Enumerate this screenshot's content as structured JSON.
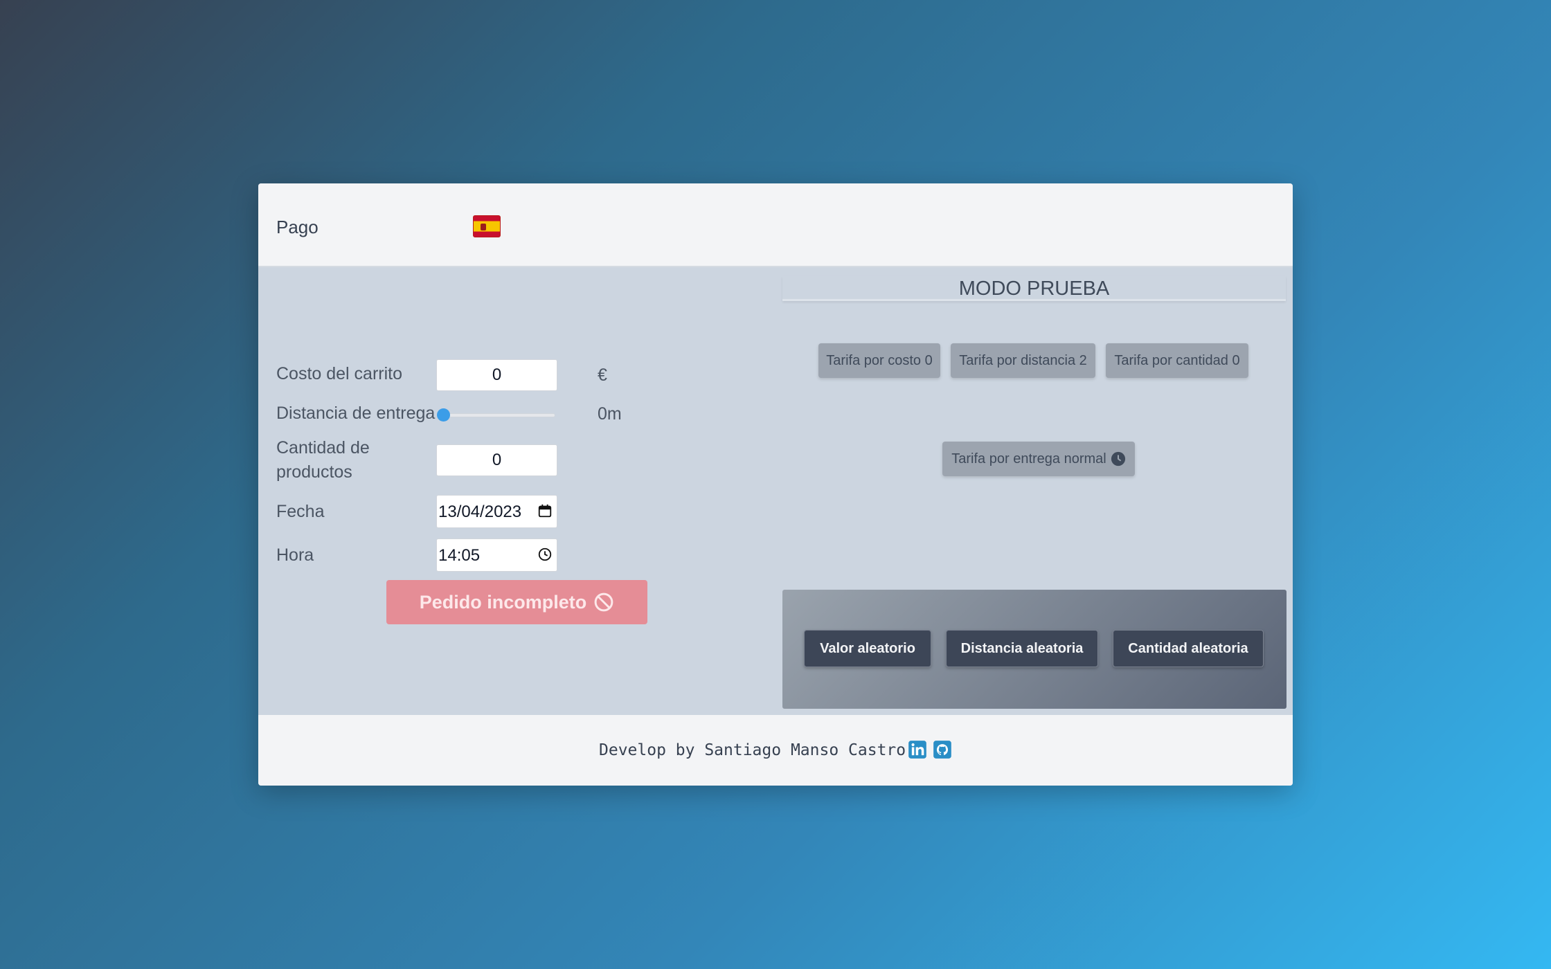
{
  "header": {
    "title": "Pago",
    "flag_icon": "spain-flag-icon"
  },
  "form": {
    "cost": {
      "label": "Costo del carrito",
      "value": "0",
      "unit": "€"
    },
    "distance": {
      "label": "Distancia de entrega",
      "value": 0,
      "unit_text": "0m"
    },
    "quantity": {
      "label": "Cantidad de productos",
      "value": "0"
    },
    "date": {
      "label": "Fecha",
      "value": "13/04/2023"
    },
    "time": {
      "label": "Hora",
      "value": "14:05"
    },
    "submit_label": "Pedido incompleto"
  },
  "test_mode": {
    "title": "MODO PRUEBA",
    "fees": {
      "cost": "Tarifa por costo 0",
      "distance": "Tarifa por distancia 2",
      "quantity": "Tarifa por cantidad 0",
      "delivery": "Tarifa por entrega normal"
    },
    "random_buttons": {
      "value": "Valor aleatorio",
      "distance": "Distancia aleatoria",
      "quantity": "Cantidad aleatoria"
    }
  },
  "footer": {
    "credit": "Develop by Santiago Manso Castro"
  },
  "colors": {
    "accent": "#3b9de8",
    "submit_bg": "#e58d96",
    "random_btn": "#3d4657"
  }
}
